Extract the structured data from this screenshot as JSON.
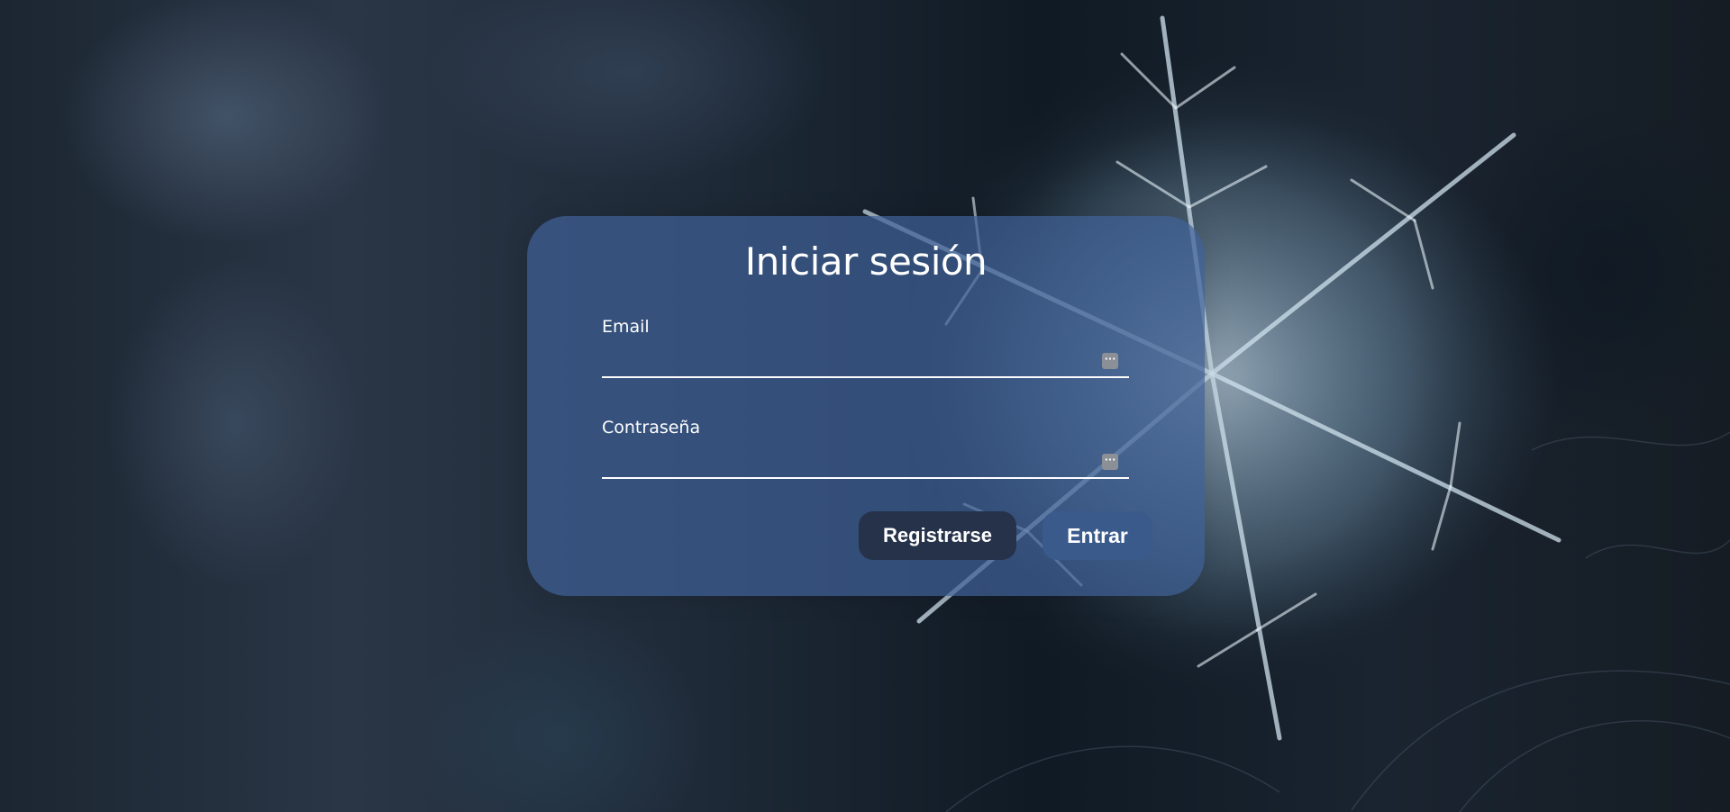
{
  "login": {
    "title": "Iniciar sesión",
    "email_label": "Email",
    "email_value": "",
    "password_label": "Contraseña",
    "password_value": "",
    "register_button": "Registrarse",
    "enter_button": "Entrar",
    "field_action_icon": "password-manager-icon"
  },
  "colors": {
    "card": "#3e6096",
    "register_button": "#25324a",
    "enter_button": "#3a5a8c",
    "text": "#ffffff"
  }
}
